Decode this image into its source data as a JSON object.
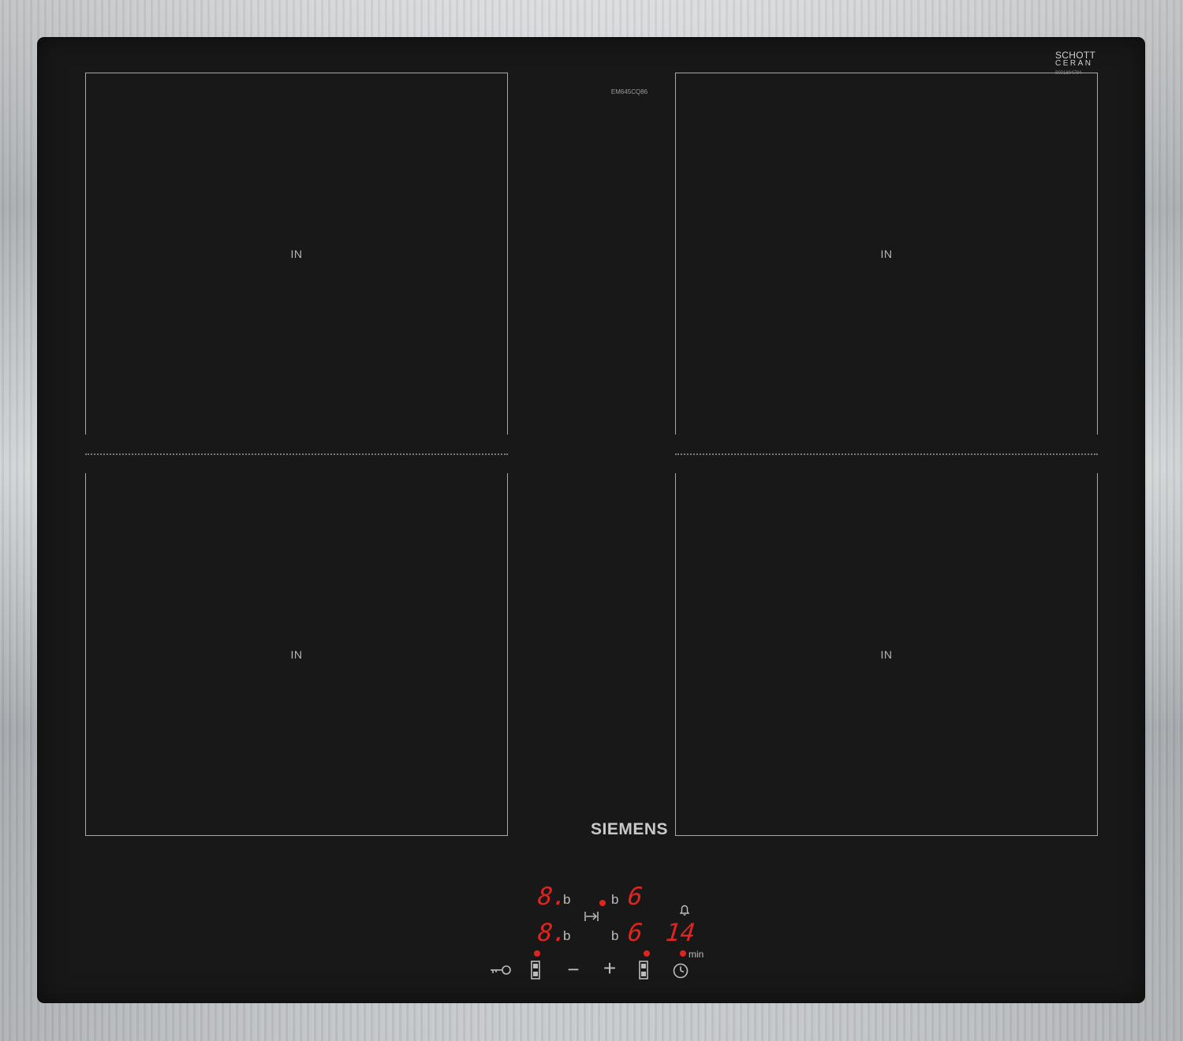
{
  "model_number": "EM645CQ86",
  "glass_brand": {
    "line1": "SCHOTT",
    "line2": "CERAN",
    "code": "9001804794"
  },
  "appliance_brand": "SIEMENS",
  "zones": [
    {
      "label": "IN"
    },
    {
      "label": "IN"
    },
    {
      "label": "IN"
    },
    {
      "label": "IN"
    }
  ],
  "display": {
    "front_left_level": "8.",
    "rear_left_level": "8.",
    "front_right_level": "6",
    "rear_right_level": "6",
    "left_suffix_top": "b",
    "left_suffix_bottom": "b",
    "right_prefix_top": "b",
    "right_prefix_bottom": "b",
    "timer_value": "14",
    "timer_unit": "min"
  },
  "controls": {
    "minus": "−",
    "plus": "+"
  },
  "colors": {
    "glass": "#181818",
    "led_red": "#e0241f",
    "print_grey": "#bdbdbd"
  },
  "icons": [
    "lock-key-icon",
    "left-zone-select-icon",
    "minus-icon",
    "plus-icon",
    "right-zone-select-icon",
    "timer-clock-icon",
    "bell-icon",
    "flex-zone-icon"
  ]
}
